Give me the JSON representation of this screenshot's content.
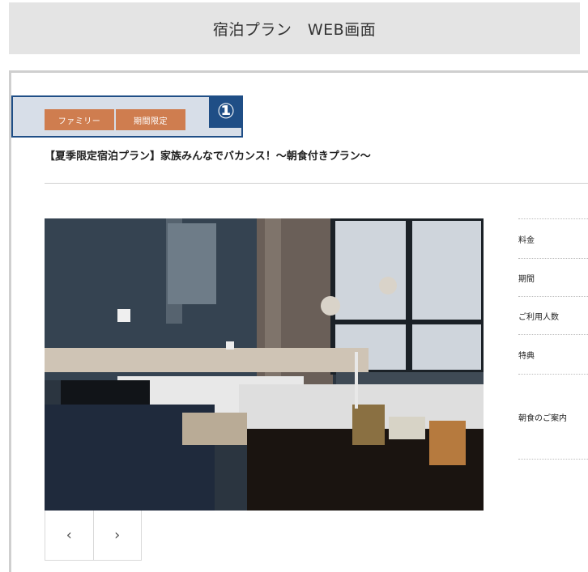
{
  "header": {
    "title": "宿泊プラン　WEB画面"
  },
  "plan": {
    "tags": [
      "ファミリー",
      "期間限定"
    ],
    "marker": "①",
    "title": "【夏季限定宿泊プラン】家族みんなでバカンス！～朝食付きプラン～"
  },
  "gallery": {
    "prev_icon": "chevron-left-icon",
    "next_icon": "chevron-right-icon",
    "prev_glyph": "‹",
    "next_glyph": "›"
  },
  "info": {
    "rows": [
      "料金",
      "期間",
      "ご利用人数",
      "特典",
      "朝食のご案内"
    ]
  },
  "colors": {
    "tag_bg": "#cf7d4f",
    "marker_bg": "#1f4e86",
    "header_bg": "#e4e4e4"
  }
}
